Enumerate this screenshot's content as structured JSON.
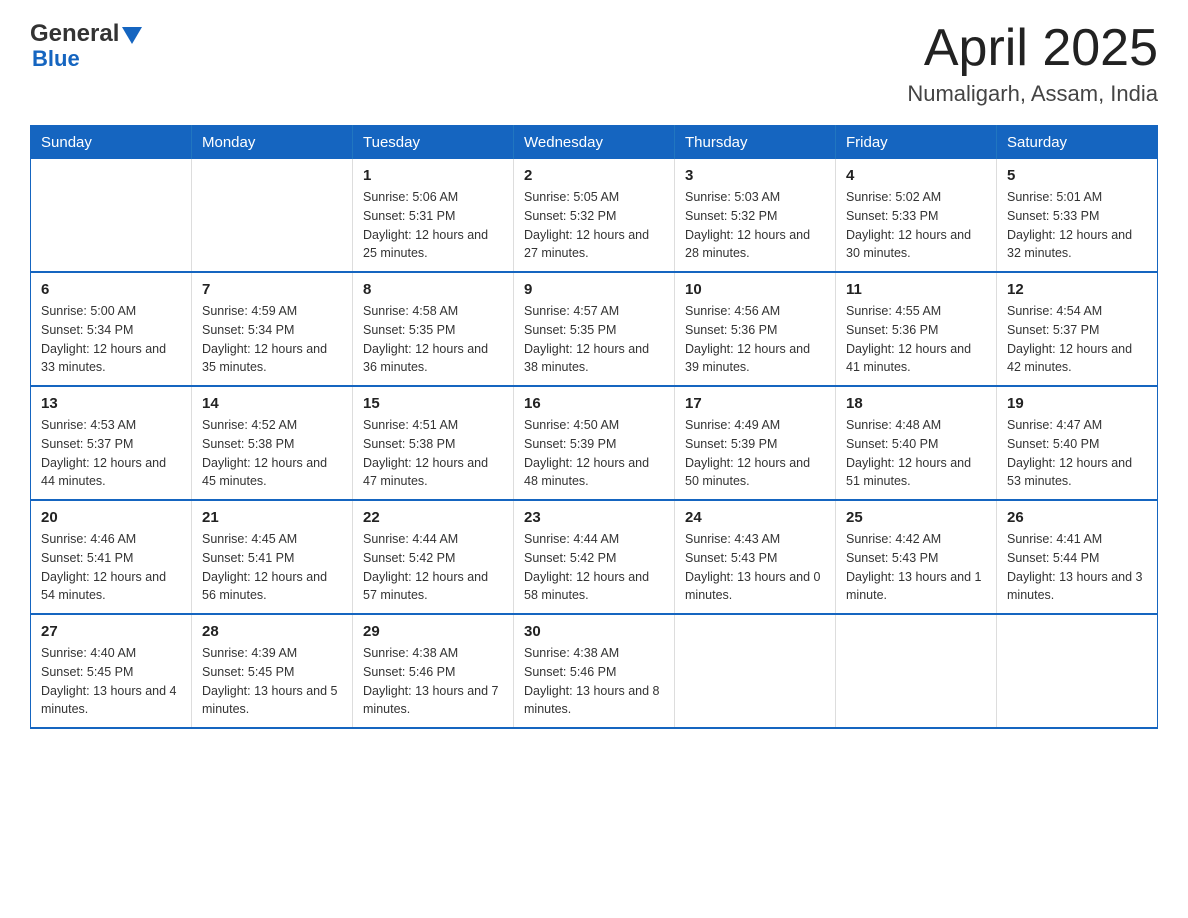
{
  "header": {
    "logo": {
      "general": "General",
      "blue": "Blue"
    },
    "title": "April 2025",
    "location": "Numaligarh, Assam, India"
  },
  "weekdays": [
    "Sunday",
    "Monday",
    "Tuesday",
    "Wednesday",
    "Thursday",
    "Friday",
    "Saturday"
  ],
  "weeks": [
    [
      {
        "day": "",
        "sunrise": "",
        "sunset": "",
        "daylight": ""
      },
      {
        "day": "",
        "sunrise": "",
        "sunset": "",
        "daylight": ""
      },
      {
        "day": "1",
        "sunrise": "Sunrise: 5:06 AM",
        "sunset": "Sunset: 5:31 PM",
        "daylight": "Daylight: 12 hours and 25 minutes."
      },
      {
        "day": "2",
        "sunrise": "Sunrise: 5:05 AM",
        "sunset": "Sunset: 5:32 PM",
        "daylight": "Daylight: 12 hours and 27 minutes."
      },
      {
        "day": "3",
        "sunrise": "Sunrise: 5:03 AM",
        "sunset": "Sunset: 5:32 PM",
        "daylight": "Daylight: 12 hours and 28 minutes."
      },
      {
        "day": "4",
        "sunrise": "Sunrise: 5:02 AM",
        "sunset": "Sunset: 5:33 PM",
        "daylight": "Daylight: 12 hours and 30 minutes."
      },
      {
        "day": "5",
        "sunrise": "Sunrise: 5:01 AM",
        "sunset": "Sunset: 5:33 PM",
        "daylight": "Daylight: 12 hours and 32 minutes."
      }
    ],
    [
      {
        "day": "6",
        "sunrise": "Sunrise: 5:00 AM",
        "sunset": "Sunset: 5:34 PM",
        "daylight": "Daylight: 12 hours and 33 minutes."
      },
      {
        "day": "7",
        "sunrise": "Sunrise: 4:59 AM",
        "sunset": "Sunset: 5:34 PM",
        "daylight": "Daylight: 12 hours and 35 minutes."
      },
      {
        "day": "8",
        "sunrise": "Sunrise: 4:58 AM",
        "sunset": "Sunset: 5:35 PM",
        "daylight": "Daylight: 12 hours and 36 minutes."
      },
      {
        "day": "9",
        "sunrise": "Sunrise: 4:57 AM",
        "sunset": "Sunset: 5:35 PM",
        "daylight": "Daylight: 12 hours and 38 minutes."
      },
      {
        "day": "10",
        "sunrise": "Sunrise: 4:56 AM",
        "sunset": "Sunset: 5:36 PM",
        "daylight": "Daylight: 12 hours and 39 minutes."
      },
      {
        "day": "11",
        "sunrise": "Sunrise: 4:55 AM",
        "sunset": "Sunset: 5:36 PM",
        "daylight": "Daylight: 12 hours and 41 minutes."
      },
      {
        "day": "12",
        "sunrise": "Sunrise: 4:54 AM",
        "sunset": "Sunset: 5:37 PM",
        "daylight": "Daylight: 12 hours and 42 minutes."
      }
    ],
    [
      {
        "day": "13",
        "sunrise": "Sunrise: 4:53 AM",
        "sunset": "Sunset: 5:37 PM",
        "daylight": "Daylight: 12 hours and 44 minutes."
      },
      {
        "day": "14",
        "sunrise": "Sunrise: 4:52 AM",
        "sunset": "Sunset: 5:38 PM",
        "daylight": "Daylight: 12 hours and 45 minutes."
      },
      {
        "day": "15",
        "sunrise": "Sunrise: 4:51 AM",
        "sunset": "Sunset: 5:38 PM",
        "daylight": "Daylight: 12 hours and 47 minutes."
      },
      {
        "day": "16",
        "sunrise": "Sunrise: 4:50 AM",
        "sunset": "Sunset: 5:39 PM",
        "daylight": "Daylight: 12 hours and 48 minutes."
      },
      {
        "day": "17",
        "sunrise": "Sunrise: 4:49 AM",
        "sunset": "Sunset: 5:39 PM",
        "daylight": "Daylight: 12 hours and 50 minutes."
      },
      {
        "day": "18",
        "sunrise": "Sunrise: 4:48 AM",
        "sunset": "Sunset: 5:40 PM",
        "daylight": "Daylight: 12 hours and 51 minutes."
      },
      {
        "day": "19",
        "sunrise": "Sunrise: 4:47 AM",
        "sunset": "Sunset: 5:40 PM",
        "daylight": "Daylight: 12 hours and 53 minutes."
      }
    ],
    [
      {
        "day": "20",
        "sunrise": "Sunrise: 4:46 AM",
        "sunset": "Sunset: 5:41 PM",
        "daylight": "Daylight: 12 hours and 54 minutes."
      },
      {
        "day": "21",
        "sunrise": "Sunrise: 4:45 AM",
        "sunset": "Sunset: 5:41 PM",
        "daylight": "Daylight: 12 hours and 56 minutes."
      },
      {
        "day": "22",
        "sunrise": "Sunrise: 4:44 AM",
        "sunset": "Sunset: 5:42 PM",
        "daylight": "Daylight: 12 hours and 57 minutes."
      },
      {
        "day": "23",
        "sunrise": "Sunrise: 4:44 AM",
        "sunset": "Sunset: 5:42 PM",
        "daylight": "Daylight: 12 hours and 58 minutes."
      },
      {
        "day": "24",
        "sunrise": "Sunrise: 4:43 AM",
        "sunset": "Sunset: 5:43 PM",
        "daylight": "Daylight: 13 hours and 0 minutes."
      },
      {
        "day": "25",
        "sunrise": "Sunrise: 4:42 AM",
        "sunset": "Sunset: 5:43 PM",
        "daylight": "Daylight: 13 hours and 1 minute."
      },
      {
        "day": "26",
        "sunrise": "Sunrise: 4:41 AM",
        "sunset": "Sunset: 5:44 PM",
        "daylight": "Daylight: 13 hours and 3 minutes."
      }
    ],
    [
      {
        "day": "27",
        "sunrise": "Sunrise: 4:40 AM",
        "sunset": "Sunset: 5:45 PM",
        "daylight": "Daylight: 13 hours and 4 minutes."
      },
      {
        "day": "28",
        "sunrise": "Sunrise: 4:39 AM",
        "sunset": "Sunset: 5:45 PM",
        "daylight": "Daylight: 13 hours and 5 minutes."
      },
      {
        "day": "29",
        "sunrise": "Sunrise: 4:38 AM",
        "sunset": "Sunset: 5:46 PM",
        "daylight": "Daylight: 13 hours and 7 minutes."
      },
      {
        "day": "30",
        "sunrise": "Sunrise: 4:38 AM",
        "sunset": "Sunset: 5:46 PM",
        "daylight": "Daylight: 13 hours and 8 minutes."
      },
      {
        "day": "",
        "sunrise": "",
        "sunset": "",
        "daylight": ""
      },
      {
        "day": "",
        "sunrise": "",
        "sunset": "",
        "daylight": ""
      },
      {
        "day": "",
        "sunrise": "",
        "sunset": "",
        "daylight": ""
      }
    ]
  ]
}
